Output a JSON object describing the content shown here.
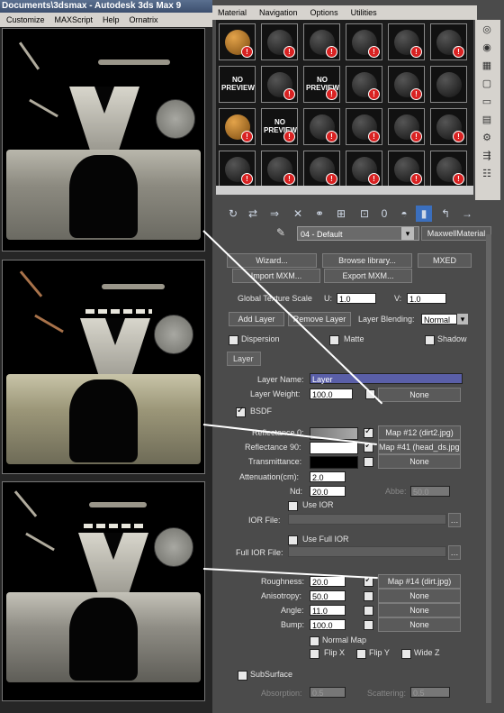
{
  "max_window": {
    "title": "Documents\\3dsmax    - Autodesk 3ds Max 9",
    "menu": [
      "Customize",
      "MAXScript",
      "Help",
      "Ornatrix"
    ]
  },
  "material_editor": {
    "menu": [
      "Material",
      "Navigation",
      "Options",
      "Utilities"
    ],
    "slots": [
      {
        "kind": "orange",
        "warn": true
      },
      {
        "kind": "dark",
        "warn": true
      },
      {
        "kind": "dark",
        "warn": true
      },
      {
        "kind": "dark",
        "warn": true
      },
      {
        "kind": "dark",
        "warn": true
      },
      {
        "kind": "dark",
        "warn": true
      },
      {
        "kind": "nopreview",
        "warn": false
      },
      {
        "kind": "dark",
        "warn": true
      },
      {
        "kind": "nopreview",
        "warn": true
      },
      {
        "kind": "dark",
        "warn": true
      },
      {
        "kind": "dark",
        "warn": true
      },
      {
        "kind": "dark",
        "warn": false
      },
      {
        "kind": "orange",
        "warn": true
      },
      {
        "kind": "nopreview",
        "warn": true
      },
      {
        "kind": "dark",
        "warn": true
      },
      {
        "kind": "dark",
        "warn": true
      },
      {
        "kind": "dark",
        "warn": true
      },
      {
        "kind": "dark",
        "warn": true
      },
      {
        "kind": "dark",
        "warn": true
      },
      {
        "kind": "dark",
        "warn": true
      },
      {
        "kind": "dark",
        "warn": true
      },
      {
        "kind": "dark",
        "warn": true
      },
      {
        "kind": "dark",
        "warn": true
      },
      {
        "kind": "dark",
        "warn": true
      }
    ],
    "no_preview_text": "NO PREVIEW",
    "material_name": "04 - Default",
    "material_type": "MaxwellMaterial",
    "toolbar_count": "0"
  },
  "maxwell": {
    "wizard": "Wizard...",
    "browse_library": "Browse library...",
    "mxed": "MXED",
    "import_mxm": "Import MXM...",
    "export_mxm": "Export MXM...",
    "global_texture_scale": "Global Texture Scale",
    "u_label": "U:",
    "u_value": "1.0",
    "v_label": "V:",
    "v_value": "1.0",
    "add_layer": "Add Layer",
    "remove_layer": "Remove Layer",
    "layer_blending": "Layer Blending:",
    "blending_value": "Normal",
    "dispersion": "Dispersion",
    "matte": "Matte",
    "shadow": "Shadow",
    "layer_rollup": "Layer",
    "layer_name_label": "Layer Name:",
    "layer_name_value": "Layer",
    "layer_weight_label": "Layer Weight:",
    "layer_weight_value": "100.0",
    "none": "None",
    "bsdf": "BSDF",
    "reflectance0_label": "Reflectance 0:",
    "reflectance0_map": "Map #12 (dirt2.jpg)",
    "reflectance90_label": "Reflectance 90:",
    "reflectance90_map": "Map #41 (head_ds.jpg)",
    "transmittance_label": "Transmittance:",
    "attenuation_label": "Attenuation(cm):",
    "attenuation_value": "2.0",
    "nd_label": "Nd:",
    "nd_value": "20.0",
    "abbe_label": "Abbe:",
    "abbe_value": "50.0",
    "use_ior": "Use IOR",
    "ior_file": "IOR File:",
    "use_full_ior": "Use Full IOR",
    "full_ior_file": "Full IOR File:",
    "roughness_label": "Roughness:",
    "roughness_value": "20.0",
    "roughness_map": "Map #14 (dirt.jpg)",
    "anisotropy_label": "Anisotropy:",
    "anisotropy_value": "50.0",
    "angle_label": "Angle:",
    "angle_value": "11.0",
    "bump_label": "Bump:",
    "bump_value": "100.0",
    "normal_map": "Normal Map",
    "flip_x": "Flip X",
    "flip_y": "Flip Y",
    "wide_z": "Wide Z",
    "subsurface": "SubSurface",
    "absorption_label": "Absorption:",
    "absorption_value": "0.5",
    "scattering_label": "Scattering:",
    "scattering_value": "0.5"
  }
}
